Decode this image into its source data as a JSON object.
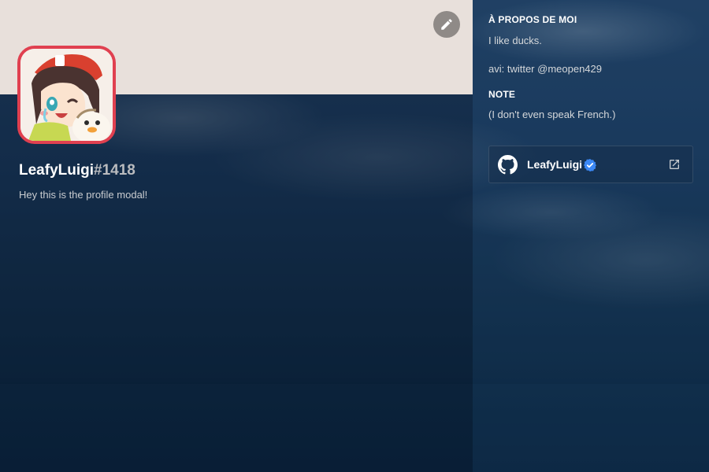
{
  "profile": {
    "username": "LeafyLuigi",
    "discriminator": "#1418",
    "custom_status": "Hey this is the profile modal!",
    "banner_color": "#e8e0db",
    "avatar_border_color": "#e04050"
  },
  "about": {
    "title": "À PROPOS DE MOI",
    "line1": "I like ducks.",
    "line2": "avi: twitter @meopen429"
  },
  "note": {
    "title": "NOTE",
    "text": "(I don't even speak French.)"
  },
  "connection": {
    "service_icon": "github-icon",
    "name": "LeafyLuigi",
    "verified_icon": "verified-badge-icon",
    "external_icon": "external-link-icon"
  },
  "actions": {
    "edit_icon": "pencil-icon"
  },
  "colors": {
    "verified": "#3b88f5",
    "accent_border": "#e04050"
  }
}
